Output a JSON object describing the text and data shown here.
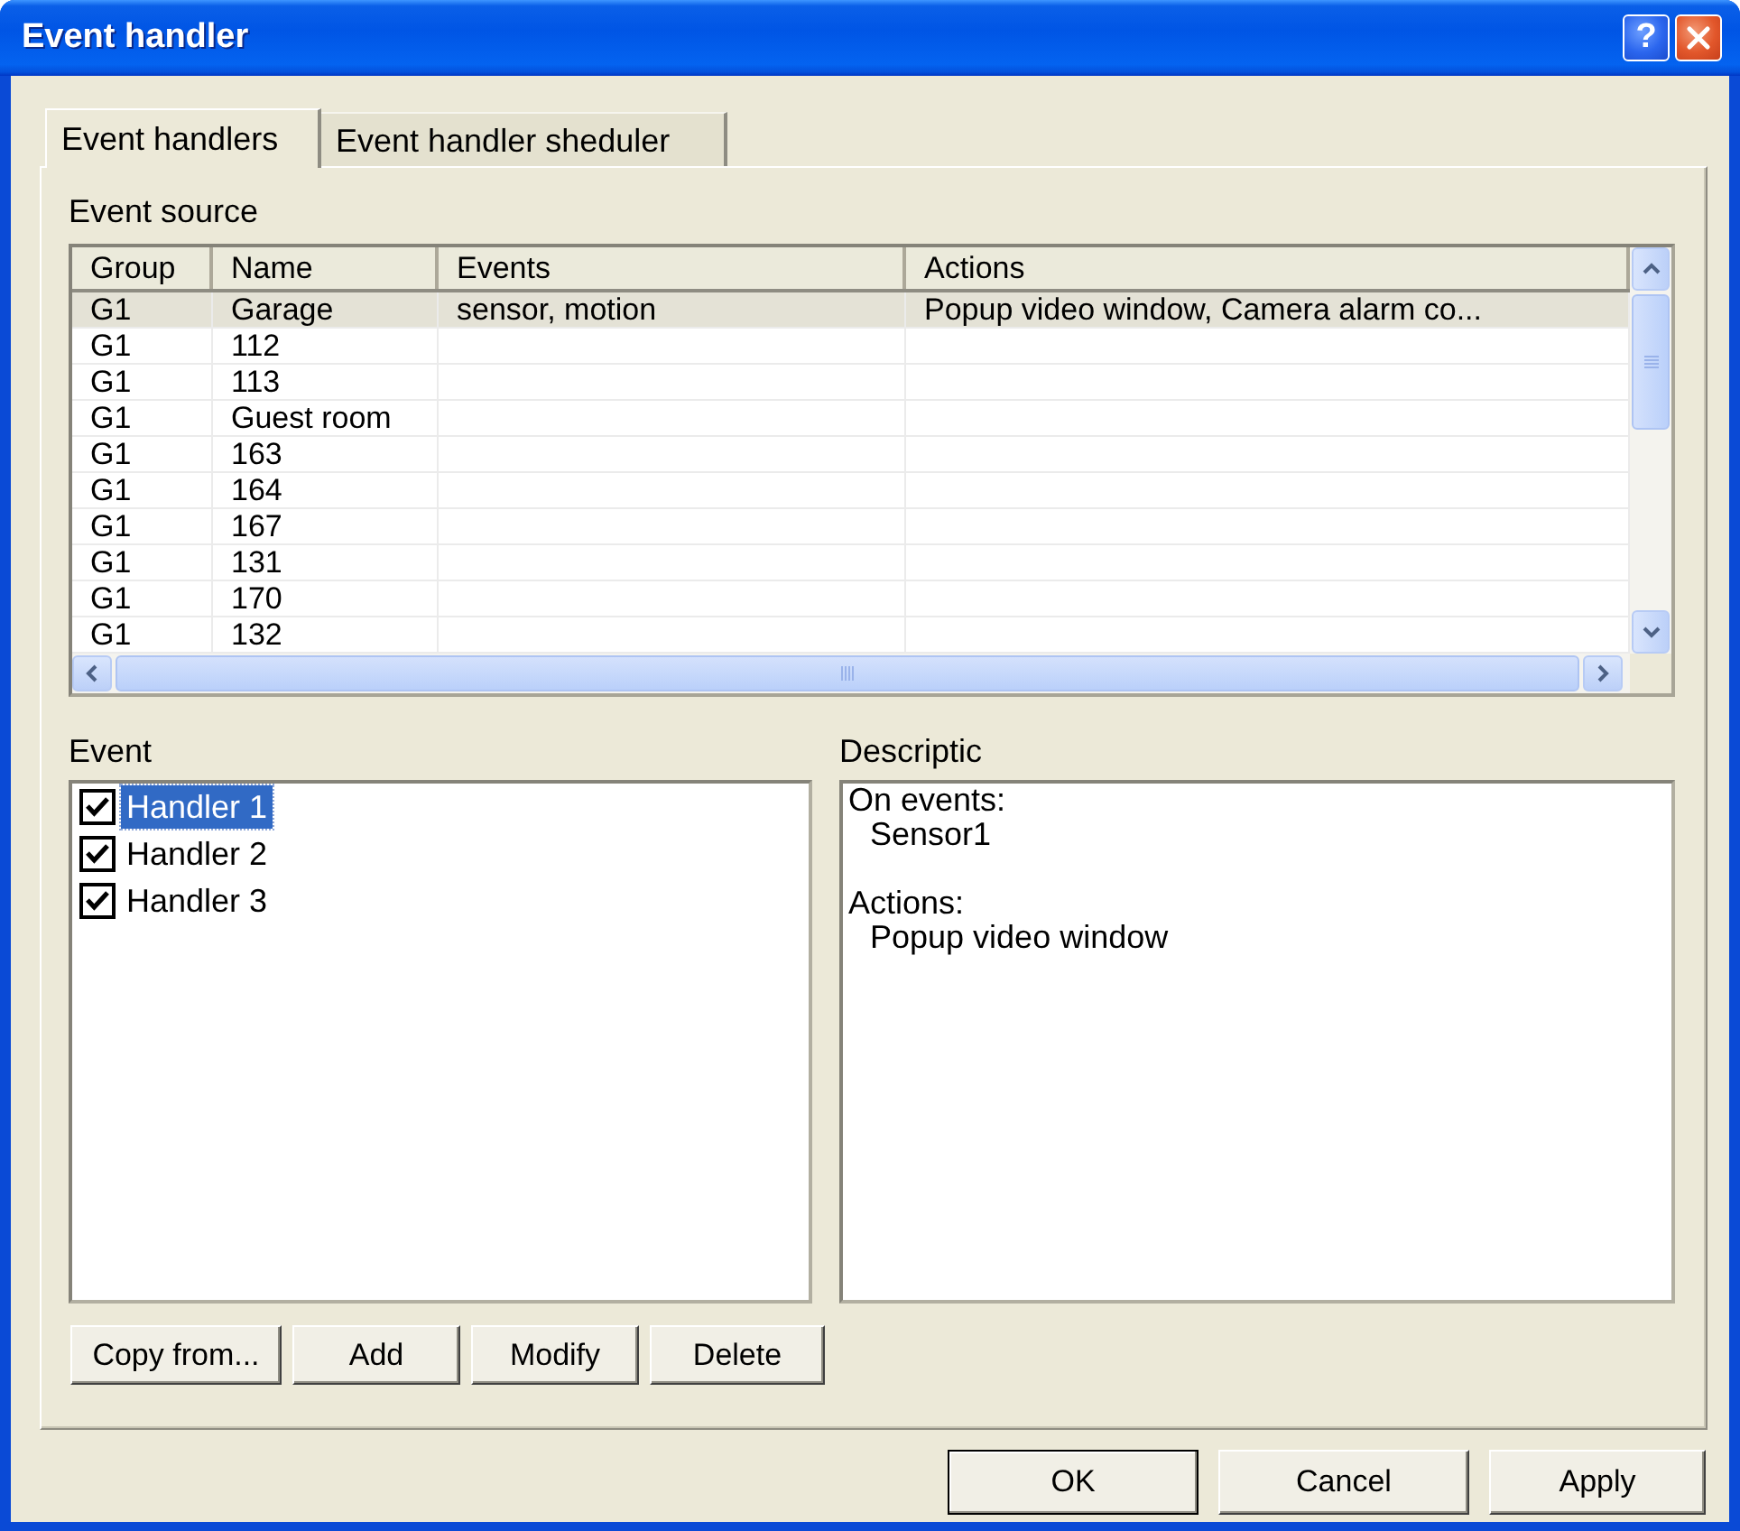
{
  "window": {
    "title": "Event handler",
    "help_button": "?"
  },
  "tabs": [
    {
      "label": "Event handlers",
      "selected": true
    },
    {
      "label": "Event handler sheduler",
      "selected": false
    }
  ],
  "event_source": {
    "label": "Event source",
    "table": {
      "columns": [
        "Group",
        "Name",
        "Events",
        "Actions"
      ],
      "rows": [
        {
          "group": "G1",
          "name": "Garage",
          "events": "sensor, motion",
          "actions": "Popup video window, Camera alarm co...",
          "selected": true
        },
        {
          "group": "G1",
          "name": "112",
          "selected": false
        },
        {
          "group": "G1",
          "name": "113",
          "selected": false
        },
        {
          "group": "G1",
          "name": "Guest room",
          "selected": false
        },
        {
          "group": "G1",
          "name": "163",
          "selected": false
        },
        {
          "group": "G1",
          "name": "164",
          "selected": false
        },
        {
          "group": "G1",
          "name": "167",
          "selected": false
        },
        {
          "group": "G1",
          "name": "131",
          "selected": false
        },
        {
          "group": "G1",
          "name": "170",
          "selected": false
        },
        {
          "group": "G1",
          "name": "132",
          "selected": false
        }
      ]
    }
  },
  "event": {
    "label": "Event",
    "handlers": [
      {
        "label": "Handler 1",
        "checked": true,
        "selected": true
      },
      {
        "label": "Handler 2",
        "checked": true,
        "selected": false
      },
      {
        "label": "Handler 3",
        "checked": true,
        "selected": false
      }
    ],
    "buttons": [
      {
        "label": "Copy from..."
      },
      {
        "label": "Add"
      },
      {
        "label": "Modify"
      },
      {
        "label": "Delete"
      }
    ]
  },
  "description": {
    "label": "Descriptic",
    "sections": [
      {
        "heading": "On events:",
        "items": [
          "Sensor1"
        ]
      },
      {
        "heading": "Actions:",
        "items": [
          "Popup video window"
        ]
      }
    ]
  },
  "dialog_buttons": [
    {
      "label": "OK",
      "default": true
    },
    {
      "label": "Cancel",
      "default": false
    },
    {
      "label": "Apply",
      "default": false
    }
  ]
}
